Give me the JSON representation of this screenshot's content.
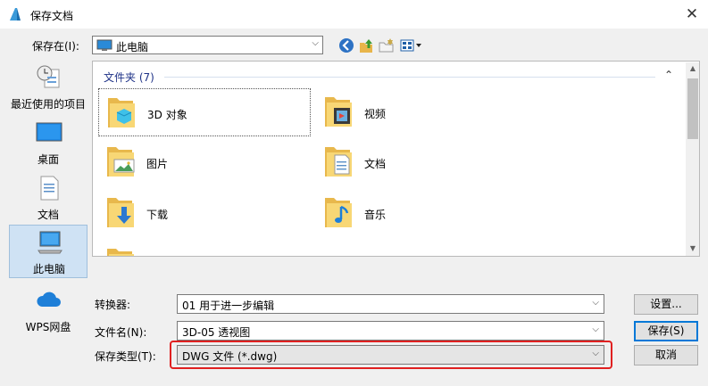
{
  "window": {
    "title": "保存文档",
    "close_glyph": "✕"
  },
  "save_in": {
    "label": "保存在(I):",
    "value": "此电脑"
  },
  "places": [
    {
      "label": "最近使用的项目",
      "icon": "recent-icon"
    },
    {
      "label": "桌面",
      "icon": "desktop-icon"
    },
    {
      "label": "文档",
      "icon": "documents-icon"
    },
    {
      "label": "此电脑",
      "icon": "computer-icon",
      "selected": true
    },
    {
      "label": "WPS网盘",
      "icon": "cloud-icon"
    }
  ],
  "file_pane": {
    "group_header": "文件夹 (7)",
    "items": [
      {
        "label": "3D 对象",
        "icon": "3d-objects-folder-icon"
      },
      {
        "label": "视频",
        "icon": "videos-folder-icon"
      },
      {
        "label": "图片",
        "icon": "pictures-folder-icon"
      },
      {
        "label": "文档",
        "icon": "documents-folder-icon"
      },
      {
        "label": "下载",
        "icon": "downloads-folder-icon"
      },
      {
        "label": "音乐",
        "icon": "music-folder-icon"
      }
    ]
  },
  "form": {
    "converter_label": "转换器:",
    "converter_value": "01 用于进一步编辑",
    "filename_label": "文件名(N):",
    "filename_value": "3D-05 透视图",
    "filetype_label": "保存类型(T):",
    "filetype_value": "DWG 文件 (*.dwg)"
  },
  "buttons": {
    "settings": "设置...",
    "save": "保存(S)",
    "cancel": "取消"
  },
  "colors": {
    "highlight": "#e02020",
    "accent": "#0078d7",
    "group_header": "#1e3287"
  }
}
